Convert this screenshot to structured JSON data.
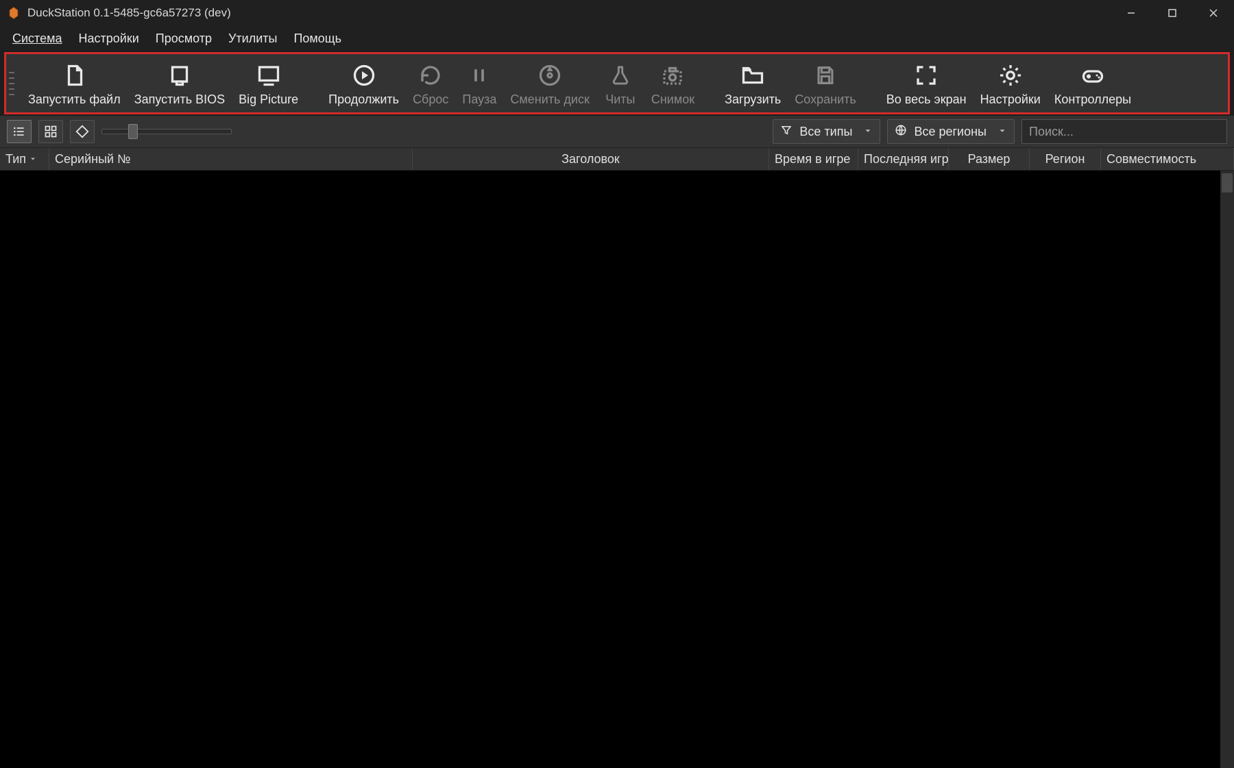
{
  "window": {
    "title": "DuckStation 0.1-5485-gc6a57273 (dev)"
  },
  "menu": {
    "system": "Система",
    "settings": "Настройки",
    "view": "Просмотр",
    "tools": "Утилиты",
    "help": "Помощь"
  },
  "toolbar": {
    "run_file": "Запустить файл",
    "run_bios": "Запустить BIOS",
    "big_picture": "Big Picture",
    "resume": "Продолжить",
    "reset": "Сброс",
    "pause": "Пауза",
    "change_disc": "Сменить диск",
    "cheats": "Читы",
    "screenshot": "Снимок",
    "load": "Загрузить",
    "save": "Сохранить",
    "fullscreen": "Во весь экран",
    "settings_btn": "Настройки",
    "controllers": "Контроллеры"
  },
  "filter": {
    "type_dropdown": "Все типы",
    "region_dropdown": "Все регионы",
    "search_placeholder": "Поиск..."
  },
  "columns": {
    "type": "Тип",
    "serial": "Серийный №",
    "title": "Заголовок",
    "playtime": "Время в игре",
    "lastplayed": "Последняя игр",
    "size": "Размер",
    "region": "Регион",
    "compat": "Совместимость"
  }
}
